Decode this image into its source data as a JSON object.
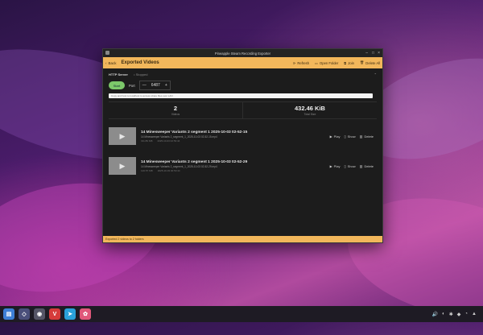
{
  "window": {
    "title": "Pineapple Steam Recording Exporter",
    "controls": [
      "–",
      "□",
      "×"
    ]
  },
  "toolbar": {
    "back_label": "Back",
    "title": "Exported Videos",
    "buttons": [
      {
        "label": "Refresh",
        "icon": "refresh-icon"
      },
      {
        "label": "Open Folder",
        "icon": "folder-icon"
      },
      {
        "label": "Join",
        "icon": "join-icon"
      },
      {
        "label": "Delete All",
        "icon": "trash-icon"
      }
    ]
  },
  "server": {
    "label": "HTTP Server",
    "status": "• Stopped",
    "collapse_icon": "chevron-up-icon",
    "start_label": "Start",
    "port_label": "Port",
    "minus": "—",
    "port_value": "6487",
    "plus": "+",
    "url_placeholder": "Copy and host to localhost to access share files over LAN"
  },
  "stats": [
    {
      "value": "2",
      "label": "Videos"
    },
    {
      "value": "432.46 KiB",
      "label": "Total Size"
    }
  ],
  "videos": [
    {
      "title": "14 Minesweeper Variants 2 segment 1 2025-10-03 02-52-15",
      "file": "14 Minesweeper Variants 2_segment_1_2025-10-03 02-52-15.mp4",
      "size": "311.89 KiB",
      "date": "2025-10-03 02:53:44"
    },
    {
      "title": "14 Minesweeper Variants 2 segment 1 2025-10-03 02-52-29",
      "file": "14 Minesweeper Variants 2_segment_1_2025-10-03 02-52-29.mp4",
      "size": "120.57 KiB",
      "date": "2025-10-03 02:53:44"
    }
  ],
  "video_actions": {
    "play": "Play",
    "show": "Show",
    "delete": "Delete"
  },
  "statusbar": {
    "text": "Exported 2 videos to 2 folders"
  },
  "taskbar": {
    "apps": [
      {
        "icon": "files-icon",
        "glyph": "▤",
        "color": "#3d7fd6"
      },
      {
        "icon": "vscode-icon",
        "glyph": "◇",
        "color": "#2b83d6"
      },
      {
        "icon": "steam-icon",
        "glyph": "◉",
        "color": "#556"
      },
      {
        "icon": "vivaldi-icon",
        "glyph": "V",
        "color": "#d63b3b"
      },
      {
        "icon": "telegram-icon",
        "glyph": "➤",
        "color": "#2aa1d9"
      },
      {
        "icon": "pineapple-icon",
        "glyph": "✿",
        "color": "#e0587a"
      }
    ],
    "tray": [
      "🔊",
      "◐",
      "✱",
      "◆",
      "◔",
      "▲"
    ]
  }
}
